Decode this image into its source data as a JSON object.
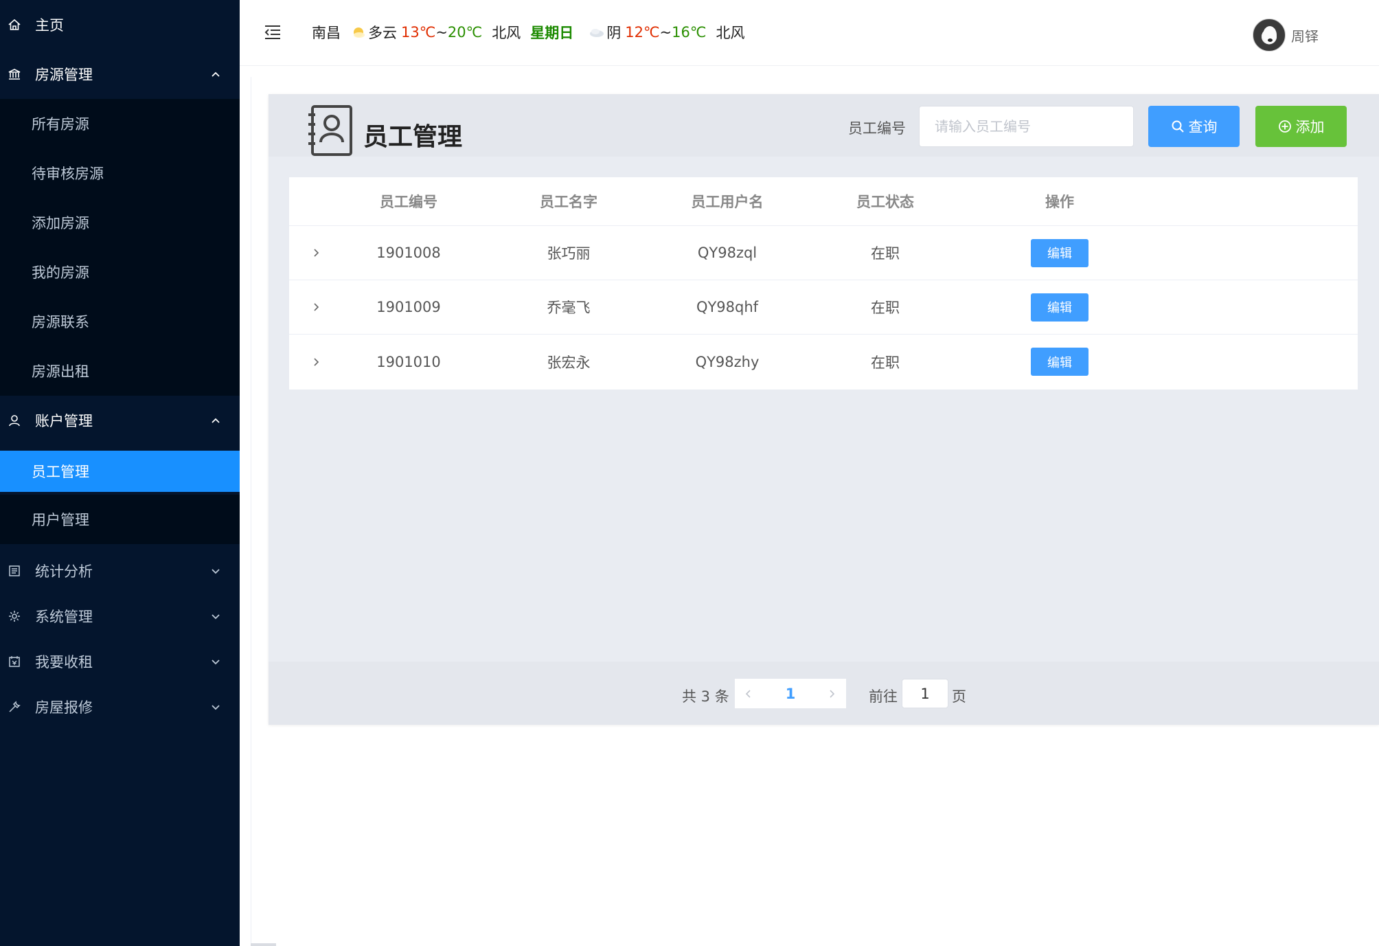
{
  "sidebar": {
    "items": [
      {
        "label": "主页",
        "icon": "home-icon"
      },
      {
        "label": "房源管理",
        "icon": "bank-icon",
        "expanded": true
      },
      {
        "label": "所有房源"
      },
      {
        "label": "待审核房源"
      },
      {
        "label": "添加房源"
      },
      {
        "label": "我的房源"
      },
      {
        "label": "房源联系"
      },
      {
        "label": "房源出租"
      },
      {
        "label": "账户管理",
        "icon": "user-icon",
        "expanded": true
      },
      {
        "label": "员工管理",
        "active": true
      },
      {
        "label": "用户管理"
      },
      {
        "label": "统计分析",
        "icon": "document-icon",
        "expanded": false
      },
      {
        "label": "系统管理",
        "icon": "gear-icon",
        "expanded": false
      },
      {
        "label": "我要收租",
        "icon": "calendar-icon",
        "expanded": false
      },
      {
        "label": "房屋报修",
        "icon": "wrench-icon",
        "expanded": false
      }
    ]
  },
  "header": {
    "city": "南昌",
    "today": {
      "weather": "多云",
      "low": "13℃",
      "sep": "~",
      "high": "20℃",
      "wind": "北风"
    },
    "weekday": "星期日",
    "tomorrow": {
      "weather": "阴",
      "low": "12℃",
      "sep": "~",
      "high": "16℃",
      "wind": "北风"
    },
    "user_name": "周铎"
  },
  "panel": {
    "title": "员工管理",
    "search_label": "员工编号",
    "search_placeholder": "请输入员工编号",
    "search_value": "",
    "query_label": "查询",
    "add_label": "添加"
  },
  "table": {
    "columns": [
      "员工编号",
      "员工名字",
      "员工用户名",
      "员工状态",
      "操作"
    ],
    "rows": [
      {
        "id": "1901008",
        "name": "张巧丽",
        "username": "QY98zql",
        "status": "在职",
        "action": "编辑"
      },
      {
        "id": "1901009",
        "name": "乔毫飞",
        "username": "QY98qhf",
        "status": "在职",
        "action": "编辑"
      },
      {
        "id": "1901010",
        "name": "张宏永",
        "username": "QY98zhy",
        "status": "在职",
        "action": "编辑"
      }
    ]
  },
  "pagination": {
    "total_text": "共 3 条",
    "current_page": "1",
    "goto_label": "前往",
    "goto_value": "1",
    "page_unit": "页"
  },
  "colors": {
    "sidebar_bg": "#04152d",
    "submenu_bg": "#000c1a",
    "active": "#1890ff",
    "primary": "#409eff",
    "success": "#67c23a",
    "temp_low": "#e02d00",
    "temp_high": "#2a8f00"
  }
}
